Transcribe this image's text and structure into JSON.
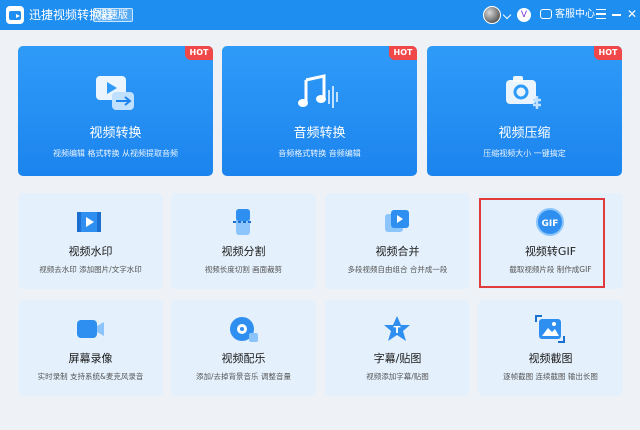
{
  "titlebar": {
    "app_name": "迅捷视频转换器",
    "edition": "极速版",
    "service_label": "客服中心"
  },
  "features": [
    {
      "title": "视频转换",
      "subtitle": "视频编辑 格式转换 从视频提取音频",
      "badge": "HOT",
      "icon": "video-convert-icon"
    },
    {
      "title": "音频转换",
      "subtitle": "音频格式转换 音频编辑",
      "badge": "HOT",
      "icon": "music-note-icon"
    },
    {
      "title": "视频压缩",
      "subtitle": "压缩视频大小 一键搞定",
      "badge": "HOT",
      "icon": "camera-compress-icon"
    }
  ],
  "tools": [
    {
      "title": "视频水印",
      "subtitle": "视频去水印 添加图片/文字水印",
      "icon": "video-watermark-icon"
    },
    {
      "title": "视频分割",
      "subtitle": "视频长度切割 画面裁剪",
      "icon": "video-split-icon"
    },
    {
      "title": "视频合并",
      "subtitle": "多段视频自由组合 合并成一段",
      "icon": "video-merge-icon"
    },
    {
      "title": "视频转GIF",
      "subtitle": "截取视频片段 制作成GIF",
      "icon": "gif-icon"
    },
    {
      "title": "屏幕录像",
      "subtitle": "实时录制 支持系统&麦克风录音",
      "icon": "screen-record-icon"
    },
    {
      "title": "视频配乐",
      "subtitle": "添加/去掉背景音乐 调整音量",
      "icon": "video-music-icon"
    },
    {
      "title": "字幕/贴图",
      "subtitle": "视频添加字幕/贴图",
      "icon": "subtitle-sticker-icon"
    },
    {
      "title": "视频截图",
      "subtitle": "逐帧截图 连续截图 输出长图",
      "icon": "video-screenshot-icon"
    }
  ],
  "colors": {
    "brand": "#1f8ef1",
    "hot_badge": "#f04848",
    "card_bg": "#e4f0fb",
    "highlight_border": "#e23b3b"
  }
}
